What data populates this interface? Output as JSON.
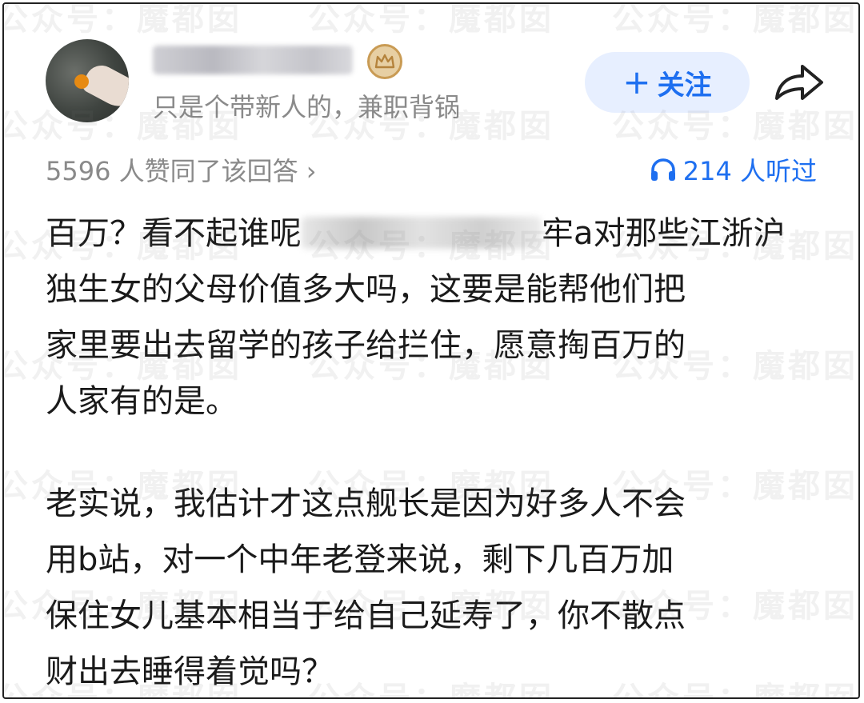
{
  "profile": {
    "bio": "只是个带新人的，兼职背锅"
  },
  "actions": {
    "follow_plus": "+",
    "follow_label": "关注"
  },
  "stats": {
    "likes_text": "5596 人赞同了该回答 ›",
    "listen_text": "214 人听过"
  },
  "answer": {
    "p1_line1_a": "百万？看不起谁呢",
    "p1_line1_b": "牢a对那些江浙沪",
    "p1_rest": "独生女的父母价值多大吗，这要是能帮他们把\n家里要出去留学的孩子给拦住，愿意掏百万的\n人家有的是。",
    "p2": "老实说，我估计才这点舰长是因为好多人不会\n用b站，对一个中年老登来说，剩下几百万加\n保住女儿基本相当于给自己延寿了，你不散点\n财出去睡得着觉吗？"
  },
  "watermark": {
    "text": "公众号：魔都囡"
  },
  "colors": {
    "accent_blue": "#1e6ff0",
    "follow_bg": "#e7efff",
    "muted_text": "#8a8a8a"
  },
  "icons": {
    "share": "share-arrow-icon",
    "headphones": "headphones-icon",
    "badge": "crown-badge-icon"
  }
}
